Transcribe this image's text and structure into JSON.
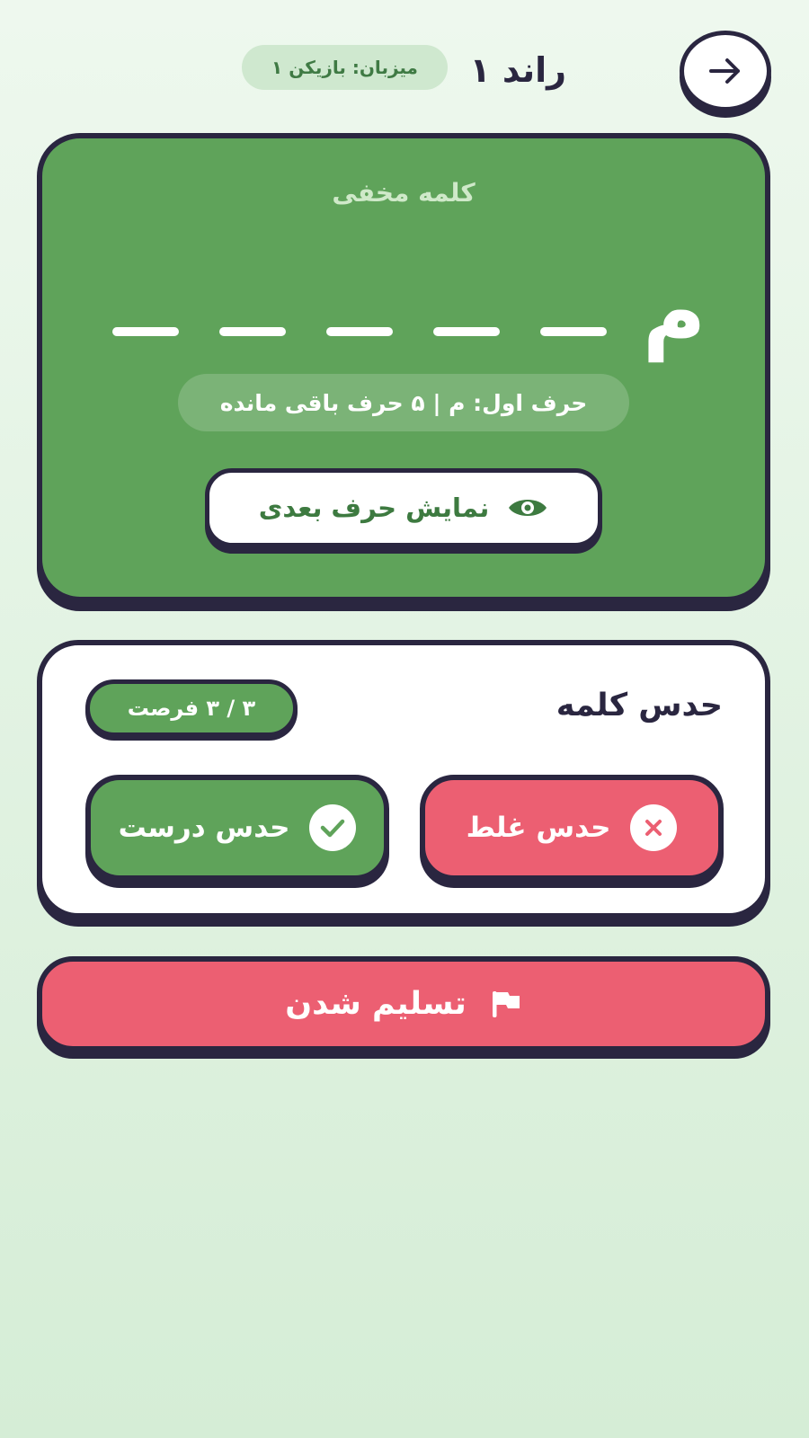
{
  "header": {
    "round_title": "راند ۱",
    "host_label": "میزبان: بازیکن ۱",
    "back_icon": "arrow-right-icon"
  },
  "word_card": {
    "label": "کلمه مخفی",
    "revealed_letter": "م",
    "hidden_slots": 5,
    "hint": "حرف اول: م | ۵ حرف باقی مانده",
    "reveal_button_label": "نمایش حرف بعدی",
    "reveal_icon": "eye-icon"
  },
  "guess_card": {
    "title": "حدس کلمه",
    "chances": "۳ / ۳ فرصت",
    "correct_label": "حدس درست",
    "wrong_label": "حدس غلط",
    "correct_icon": "check-icon",
    "wrong_icon": "close-icon"
  },
  "surrender": {
    "label": "تسلیم شدن",
    "icon": "flag-icon"
  },
  "colors": {
    "green": "#5fa35a",
    "red": "#ec5f72",
    "dark": "#2a2640",
    "white": "#ffffff"
  }
}
